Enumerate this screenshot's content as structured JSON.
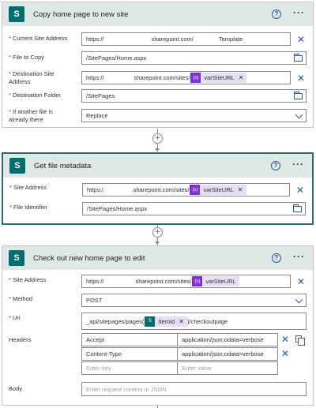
{
  "card1": {
    "title": "Copy home page to new site",
    "fields": {
      "current_site_label": "Current Site Address",
      "current_site_prefix": "https://",
      "current_site_mid": "sharepoint.com/",
      "current_site_suffix": "Template",
      "file_label": "File to Copy",
      "file_value": "/SitePages/Home.aspx",
      "dest_site_label_1": "Destination Site",
      "dest_site_label_2": "Address",
      "dest_site_prefix": "https://",
      "dest_site_mid": "sharepoint.com/sites/",
      "dest_token": "varSiteURL",
      "dest_folder_label": "Destination Folder",
      "dest_folder_value": "/SitePages",
      "exists_label_1": "If another file is",
      "exists_label_2": "already there",
      "exists_value": "Replace"
    }
  },
  "card2": {
    "title": "Get file metadata",
    "fields": {
      "site_label": "Site Address",
      "site_prefix": "https:/.",
      "site_mid": ".sharepoint.com/sites/",
      "site_token": "varSiteURL",
      "file_id_label": "File Identifier",
      "file_id_value": "/SitePages/Home.aspx"
    }
  },
  "card3": {
    "title": "Check out new home page to edit",
    "fields": {
      "site_label": "Site Address",
      "site_prefix": "https://",
      "site_mid": "sharepoint.com/sites/",
      "site_token": "varSiteURL",
      "method_label": "Method",
      "method_value": "POST",
      "uri_label": "Uri",
      "uri_prefix": "_api/sitepages/pages(",
      "uri_token": "ItemId",
      "uri_suffix": ")/checkoutpage",
      "headers_label": "Headers",
      "headers": [
        {
          "key": "Accept",
          "value": "application/json;odata=verbose"
        },
        {
          "key": "Content-Type",
          "value": "application/json;odata=verbose"
        }
      ],
      "key_placeholder": "Enter key",
      "value_placeholder": "Enter value",
      "body_label": "Body",
      "body_placeholder": "Enter request content in JSON"
    }
  },
  "icons": {
    "sharepoint": "S",
    "help": "?",
    "more": "···",
    "add": "+",
    "clear": "✕",
    "variable": "{x}"
  },
  "colors": {
    "header_bg": "#dfe8e6",
    "sharepoint": "#036c70",
    "token_bg": "#e6def5",
    "token_icon": "#7f2ed6",
    "accent": "#2b5797",
    "selected_border": "#2b6b6c",
    "required": "#a4262c"
  }
}
